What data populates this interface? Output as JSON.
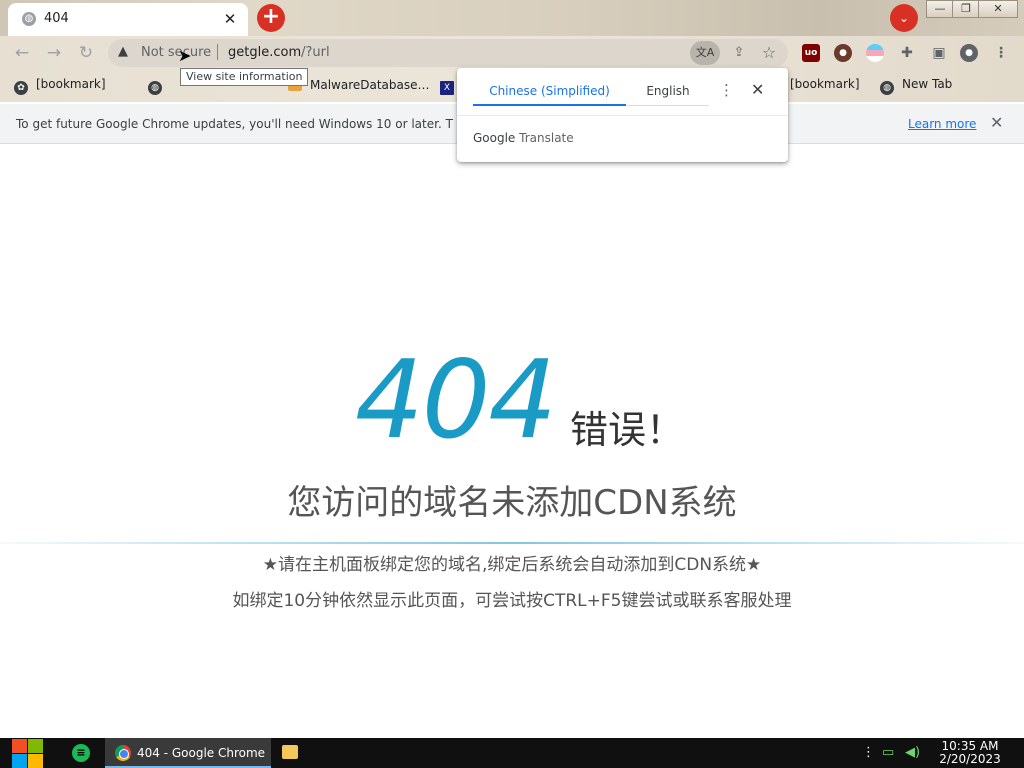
{
  "tab": {
    "title": "404"
  },
  "window": {
    "minimize": "—",
    "restore": "❐",
    "close": "✕"
  },
  "toolbar": {
    "security_label": "Not secure",
    "url_host": "getgle.com",
    "url_path": "/?url"
  },
  "tooltip": "View site information",
  "bookmarks": [
    {
      "label": "[bookmark]",
      "icon": "bookmark-icon"
    },
    {
      "label": "",
      "icon": "globe-icon"
    },
    {
      "label": "MalwareDatabase…",
      "icon": "folder-icon"
    },
    {
      "label": "",
      "icon": "x-icon"
    },
    {
      "label": "[bookmark]",
      "icon": "globe-icon"
    },
    {
      "label": "New Tab",
      "icon": "globe-icon"
    }
  ],
  "infobar": {
    "message": "To get future Google Chrome updates, you'll need Windows 10 or later. T",
    "link": "Learn more"
  },
  "translate": {
    "source_lang": "Chinese (Simplified)",
    "target_lang": "English",
    "brand_google": "Google",
    "brand_translate": "Translate"
  },
  "page": {
    "code": "404",
    "label": "错误！",
    "title": "您访问的域名未添加CDN系统",
    "line1": "★请在主机面板绑定您的域名,绑定后系统会自动添加到CDN系统★",
    "line2": "如绑定10分钟依然显示此页面，可尝试按CTRL+F5键尝试或联系客服处理",
    "accent_color": "#1a9bc6"
  },
  "taskbar": {
    "chrome_label": "404 - Google Chrome",
    "time": "10:35 AM",
    "date": "2/20/2023"
  }
}
